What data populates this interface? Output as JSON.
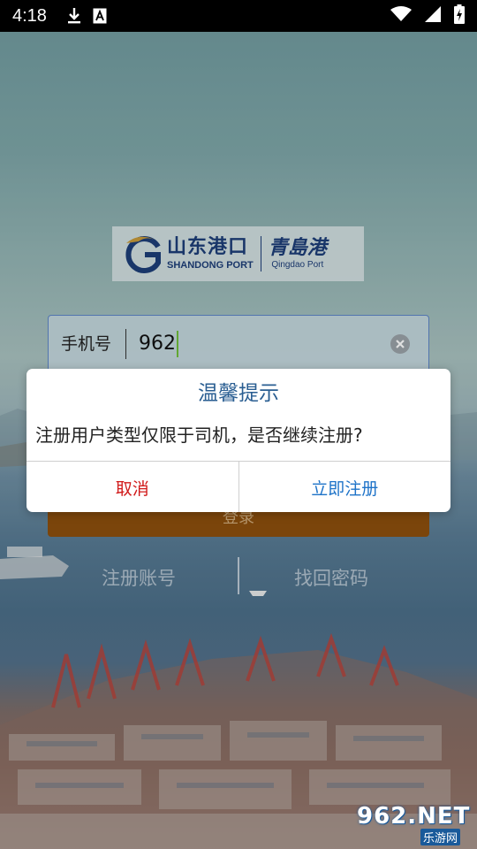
{
  "status_bar": {
    "time": "4:18",
    "icons": [
      "download-icon",
      "a-icon",
      "wifi-icon",
      "signal-icon",
      "battery-charging-icon"
    ]
  },
  "logo": {
    "shandong_cn": "山东港口",
    "shandong_en": "SHANDONG PORT",
    "qingdao_cn": "青島港",
    "qingdao_en": "Qingdao Port"
  },
  "login_form": {
    "phone_label": "手机号",
    "phone_value": "962",
    "clear_icon": "clear-icon",
    "login_button_label": "登录",
    "register_link": "注册账号",
    "recover_link": "找回密码"
  },
  "dialog": {
    "title": "温馨提示",
    "message": "注册用户类型仅限于司机，是否继续注册?",
    "cancel_label": "取消",
    "confirm_label": "立即注册"
  },
  "watermark": {
    "text": "962.NET",
    "sub": "乐游网"
  },
  "colors": {
    "dialog_title": "#2a5e92",
    "cancel": "#d11a1a",
    "confirm": "#1e73c8",
    "login_button": "#8c4f0d",
    "logo": "#1d3e78"
  }
}
